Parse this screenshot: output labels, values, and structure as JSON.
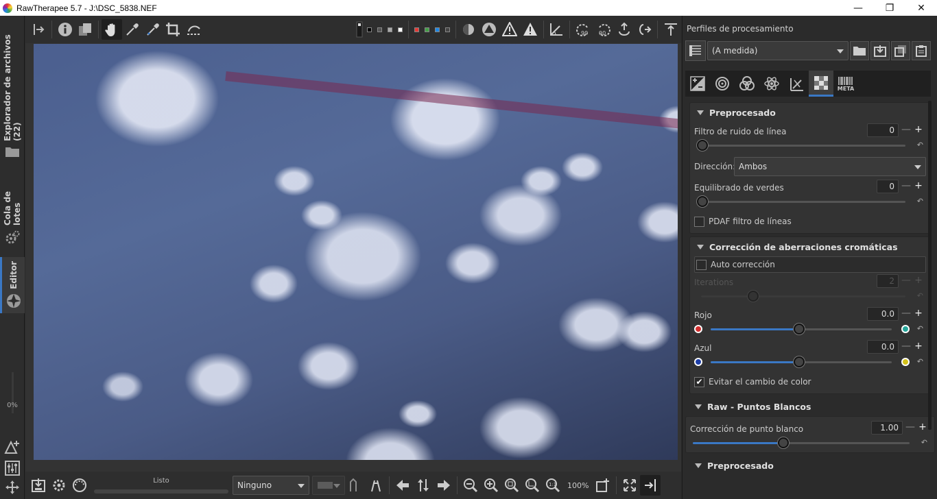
{
  "window": {
    "title": "RawTherapee 5.7 - J:\\DSC_5838.NEF",
    "minimize": "—",
    "maximize": "❐",
    "close": "✕"
  },
  "left_tabs": {
    "file_browser": "Explorador de archivos (22)",
    "queue": "Cola de lotes",
    "editor": "Editor",
    "zoom_readout": "0%"
  },
  "toolbar": {
    "icons": [
      "sidebar-toggle-icon",
      "info-icon",
      "before-after-icon",
      "hand-icon",
      "color-picker-icon",
      "white-balance-picker-icon",
      "crop-icon",
      "straighten-icon"
    ],
    "preview_swatches": [
      "#000000",
      "#555555",
      "#aaaaaa",
      "#ffffff"
    ],
    "channel_swatches": [
      "#e53935",
      "#43a047",
      "#1e88e5",
      "#444444"
    ]
  },
  "bottom": {
    "status": "Listo",
    "preset_combo": "Ninguno",
    "zoom_level": "100%"
  },
  "right_panel": {
    "title": "Perfiles de procesamiento",
    "profile_combo": "(A medida)",
    "tool_tabs": [
      "exposure",
      "detail",
      "color",
      "advanced",
      "transform",
      "raw",
      "metadata"
    ],
    "meta_label": "META",
    "sections": {
      "preprocesado": {
        "title": "Preprocesado",
        "line_noise_label": "Filtro de ruido de línea",
        "line_noise_value": "0",
        "direction_label": "Dirección:",
        "direction_value": "Ambos",
        "green_eq_label": "Equilibrado de verdes",
        "green_eq_value": "0",
        "pdaf_label": "PDAF filtro de líneas"
      },
      "ca": {
        "title": "Corrección de aberraciones cromáticas",
        "auto_label": "Auto corrección",
        "iterations_label": "Iterations",
        "iterations_value": "2",
        "red_label": "Rojo",
        "red_value": "0.0",
        "blue_label": "Azul",
        "blue_value": "0.0",
        "avoid_shift_label": "Evitar el cambio de color",
        "avoid_shift_checked": "✔"
      },
      "white_points": {
        "title": "Raw - Puntos Blancos",
        "correction_label": "Corrección de punto blanco",
        "correction_value": "1.00"
      },
      "preprocesado2": {
        "title": "Preprocesado"
      }
    },
    "minus": "—",
    "plus": "+",
    "reset": "↶"
  },
  "colors": {
    "accent": "#3a78c5",
    "panel_bg": "#2b2b2b",
    "group_bg": "#333333",
    "red_dot": "#d32f2f",
    "cyan_dot": "#26a69a",
    "blue_dot": "#1e3fa8",
    "yellow_dot": "#d4c21a"
  }
}
